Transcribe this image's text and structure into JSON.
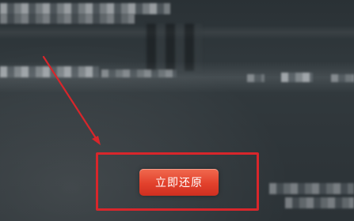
{
  "dialog": {
    "restore_button_label": "立即还原"
  },
  "annotation": {
    "color": "#d8262b",
    "arrow_icon": "arrow-down-right-icon",
    "highlight": "restore-button"
  }
}
